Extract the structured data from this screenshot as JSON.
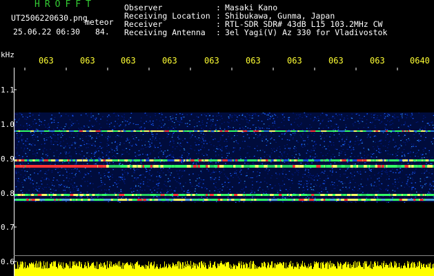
{
  "header": {
    "brand": "HROFFT",
    "filename": "UT2506220630.png",
    "meteor_label": "meteor",
    "datetime": "25.06.22 06:30",
    "count": "84.",
    "rows": [
      {
        "label": "Observer",
        "colon": ":",
        "value": "Masaki Kano"
      },
      {
        "label": "Receiving Location",
        "colon": ":",
        "value": "Shibukawa, Gunma, Japan"
      },
      {
        "label": "Receiver",
        "colon": ":",
        "value": "RTL-SDR SDR# 43dB L15 103.2MHz CW"
      },
      {
        "label": "Receiving Antenna",
        "colon": ":",
        "value": "3el Yagi(V) Az 330 for Vladivostok"
      }
    ]
  },
  "axes": {
    "y_unit": "kHz",
    "y_ticks": [
      "1.1",
      "1.0",
      "0.9",
      "0.8",
      "0.7",
      "0.6"
    ],
    "x_ticks": [
      "063",
      "063",
      "063",
      "063",
      "063",
      "063",
      "063",
      "063",
      "063",
      "0640"
    ]
  },
  "colors": {
    "background": "#000000",
    "label_text": "#ffffff",
    "brand": "#33cc33",
    "tick_labels": "#ffff33",
    "spectrum_low": "#001a80",
    "spectrum_mid": "#1a5cff",
    "spectrum_high": "#33ff66",
    "spectrum_peak": "#ff3333",
    "level_bar": "#ffff00"
  }
}
